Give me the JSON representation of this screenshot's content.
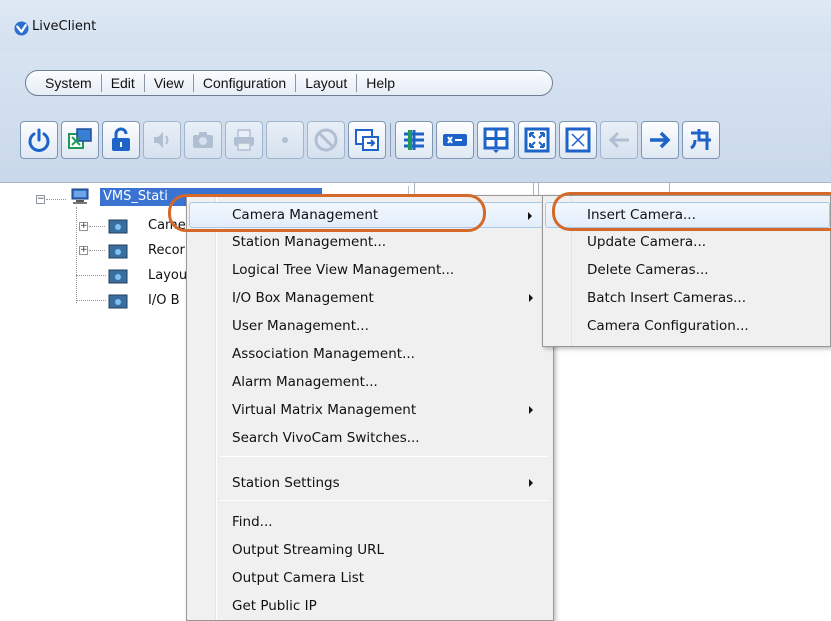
{
  "window": {
    "title": "LiveClient"
  },
  "menubar": {
    "items": [
      "System",
      "Edit",
      "View",
      "Configuration",
      "Layout",
      "Help"
    ]
  },
  "toolbar": {
    "buttons": [
      {
        "icon": "power-icon",
        "enabled": true
      },
      {
        "icon": "camera-grid-icon",
        "enabled": true
      },
      {
        "icon": "unlock-icon",
        "enabled": true
      },
      {
        "icon": "speaker-icon",
        "enabled": false
      },
      {
        "icon": "snapshot-icon",
        "enabled": false
      },
      {
        "icon": "print-icon",
        "enabled": false
      },
      {
        "icon": "record-icon",
        "enabled": false
      },
      {
        "icon": "stop-icon",
        "enabled": false
      },
      {
        "icon": "sequence-icon",
        "enabled": true
      },
      {
        "icon": "layout-grid-icon",
        "enabled": true
      },
      {
        "icon": "video-wall-icon",
        "enabled": true
      },
      {
        "icon": "split-view-icon",
        "enabled": true
      },
      {
        "icon": "fullscreen-icon",
        "enabled": true
      },
      {
        "icon": "fit-screen-icon",
        "enabled": true
      },
      {
        "icon": "back-arrow-icon",
        "enabled": false
      },
      {
        "icon": "forward-arrow-icon",
        "enabled": true
      },
      {
        "icon": "tool-icon",
        "enabled": true
      }
    ]
  },
  "tree": {
    "root": "VMS_Stati",
    "children": [
      "Came",
      "Recor",
      "Layou",
      "I/O B"
    ]
  },
  "context_menu": {
    "items": [
      {
        "label": "Camera Management",
        "submenu": true,
        "highlighted": true
      },
      {
        "label": "Station Management...",
        "submenu": false
      },
      {
        "label": "Logical Tree View Management...",
        "submenu": false
      },
      {
        "label": "I/O Box Management",
        "submenu": true
      },
      {
        "label": "User Management...",
        "submenu": false
      },
      {
        "label": "Association Management...",
        "submenu": false
      },
      {
        "label": "Alarm Management...",
        "submenu": false
      },
      {
        "label": "Virtual Matrix Management",
        "submenu": true
      },
      {
        "label": "Search VivoCam Switches...",
        "submenu": false
      },
      {
        "label": "Station Settings",
        "submenu": true
      },
      {
        "label": "Find...",
        "submenu": false
      },
      {
        "label": "Output Streaming URL",
        "submenu": false
      },
      {
        "label": "Output Camera List",
        "submenu": false
      },
      {
        "label": "Get Public IP",
        "submenu": false
      }
    ]
  },
  "submenu": {
    "items": [
      {
        "label": "Insert Camera...",
        "highlighted": true
      },
      {
        "label": "Update Camera..."
      },
      {
        "label": "Delete Cameras..."
      },
      {
        "label": "Batch Insert Cameras..."
      },
      {
        "label": "Camera Configuration..."
      }
    ]
  },
  "colors": {
    "accent_callout": "#d4692a",
    "selection": "#3a73d1",
    "chrome": "#d3e0ef"
  }
}
